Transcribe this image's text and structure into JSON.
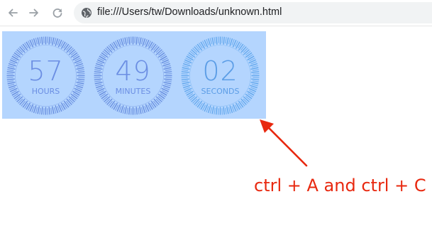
{
  "browser": {
    "url": "file:///Users/tw/Downloads/unknown.html",
    "icons": [
      "back-arrow-icon",
      "forward-arrow-icon",
      "reload-icon",
      "globe-icon"
    ]
  },
  "countdown": {
    "units": [
      {
        "value": "57",
        "label": "HOURS",
        "color": "#6b8ee3",
        "ring": "#5f86dc"
      },
      {
        "value": "49",
        "label": "MINUTES",
        "color": "#6b8ee3",
        "ring": "#5f86dc"
      },
      {
        "value": "02",
        "label": "SECONDS",
        "color": "#5b9de6",
        "ring": "#5aa3ec"
      }
    ],
    "selection_color": "#b4d5fe"
  },
  "annotation": {
    "text": "ctrl + A and ctrl + C",
    "color": "#e8280f"
  }
}
